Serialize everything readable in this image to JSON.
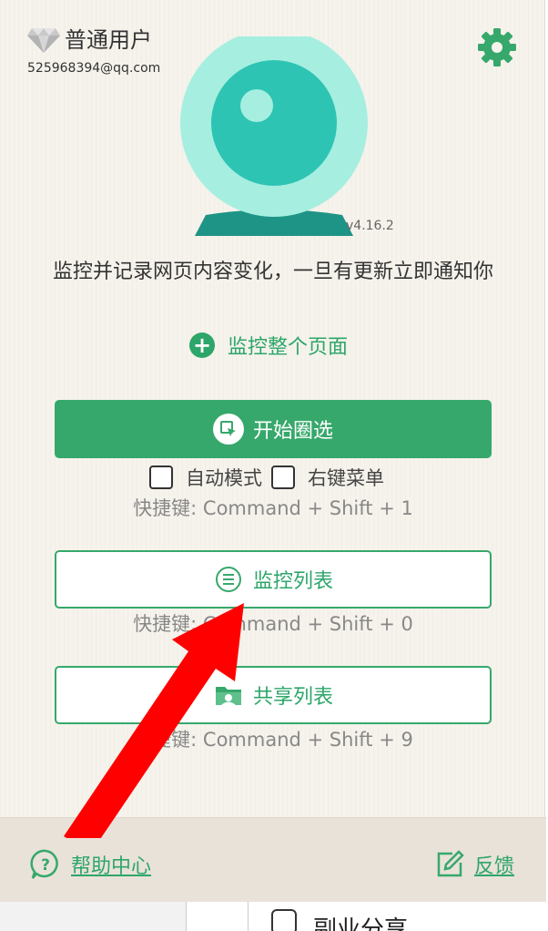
{
  "user": {
    "type": "普通用户",
    "email": "525968394@qq.com"
  },
  "app": {
    "version": "v4.16.2",
    "tagline": "监控并记录网页内容变化，一旦有更新立即通知你"
  },
  "actions": {
    "monitor_page_label": "监控整个页面",
    "start_select_label": "开始圈选",
    "auto_mode_label": "自动模式",
    "context_menu_label": "右键菜单",
    "start_select_shortcut": "快捷键: Command + Shift + 1",
    "monitor_list_label": "监控列表",
    "monitor_list_shortcut": "快捷键: Command + Shift + 0",
    "share_list_label": "共享列表",
    "share_list_shortcut": "快捷键: Command + Shift + 9"
  },
  "footer": {
    "help_label": "帮助中心",
    "feedback_label": "反馈"
  },
  "background_page": {
    "item_label": "副业分享"
  },
  "colors": {
    "accent": "#36a86b",
    "logo_outer": "#a6efe0",
    "logo_inner": "#2ec4b4",
    "logo_base": "#1e9486",
    "arrow": "#ff0000"
  },
  "icons": {
    "diamond": "diamond-icon",
    "settings": "gear-icon",
    "add": "plus-circle-icon",
    "select": "selection-cursor-icon",
    "list": "list-circle-icon",
    "share": "shared-folder-icon",
    "help": "question-bubble-icon",
    "feedback": "edit-icon",
    "annotation": "red-arrow-icon"
  }
}
